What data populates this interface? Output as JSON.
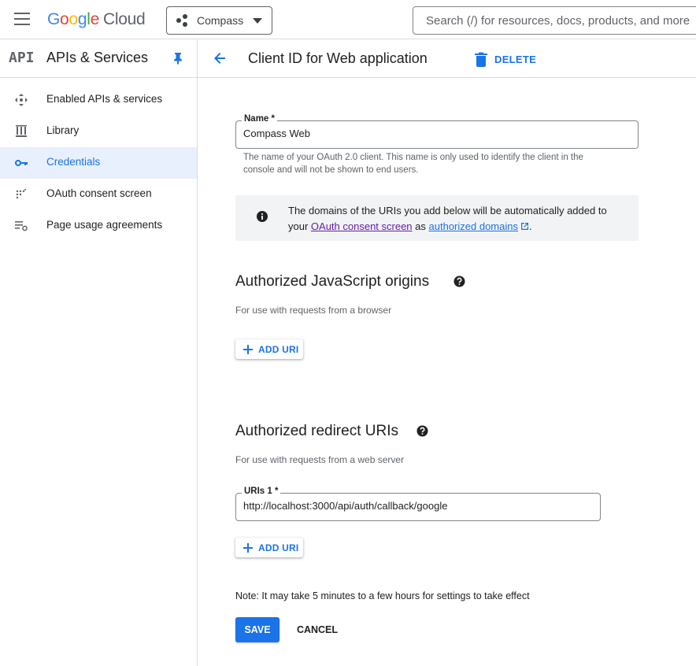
{
  "topbar": {
    "logo_google": [
      "G",
      "o",
      "o",
      "g",
      "l",
      "e"
    ],
    "logo_cloud": "Cloud",
    "project": "Compass",
    "search_placeholder": "Search (/) for resources, docs, products, and more"
  },
  "sidebar": {
    "logo_text": "API",
    "title": "APIs & Services",
    "items": [
      {
        "label": "Enabled APIs & services",
        "icon": "enabled-apis-icon",
        "active": false
      },
      {
        "label": "Library",
        "icon": "library-icon",
        "active": false
      },
      {
        "label": "Credentials",
        "icon": "key-icon",
        "active": true
      },
      {
        "label": "OAuth consent screen",
        "icon": "oauth-consent-icon",
        "active": false
      },
      {
        "label": "Page usage agreements",
        "icon": "page-usage-icon",
        "active": false
      }
    ]
  },
  "header": {
    "title": "Client ID for Web application",
    "delete_label": "DELETE"
  },
  "form": {
    "name_label": "Name *",
    "name_value": "Compass Web",
    "name_hint": "The name of your OAuth 2.0 client. This name is only used to identify the client in the console and will not be shown to end users.",
    "info_text_1": "The domains of the URIs you add below will be automatically added to your ",
    "info_link_oauth": "OAuth consent screen",
    "info_text_2": " as ",
    "info_link_domains": "authorized domains",
    "info_text_3": ".",
    "js_origins_title": "Authorized JavaScript origins",
    "js_origins_sub": "For use with requests from a browser",
    "add_uri_label": "ADD URI",
    "redirect_title": "Authorized redirect URIs",
    "redirect_sub": "For use with requests from a web server",
    "uri_label": "URIs 1 *",
    "uri_value": "http://localhost:3000/api/auth/callback/google",
    "note": "Note: It may take 5 minutes to a few hours for settings to take effect",
    "save_label": "SAVE",
    "cancel_label": "CANCEL"
  },
  "colors": {
    "accent": "#1a73e8",
    "active_bg": "#e8f0fe",
    "visited_link": "#681da8",
    "info_bg": "#f1f3f4"
  }
}
